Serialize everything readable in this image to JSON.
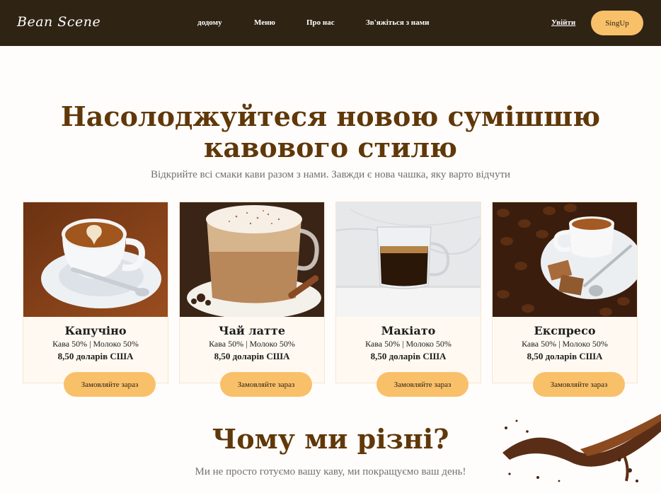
{
  "nav": {
    "logo": "Bean Scene",
    "links": [
      "додому",
      "Меню",
      "Про нас",
      "Зв'яжіться з нами"
    ],
    "login": "Увійти",
    "signup": "SingUp"
  },
  "hero": {
    "title": "Насолоджуйтеся новою сумішшю кавового стилю",
    "subtitle": "Відкрийте всі смаки кави разом з нами. Завжди є нова чашка, яку варто відчути"
  },
  "products": [
    {
      "name": "Капучіно",
      "mix": "Кава 50% | Молоко 50%",
      "price": "8,50 доларів США",
      "button": "Замовляйте зараз"
    },
    {
      "name": "Чай латте",
      "mix": "Кава 50% | Молоко 50%",
      "price": "8,50 доларів США",
      "button": "Замовляйте зараз"
    },
    {
      "name": "Макіато",
      "mix": "Кава 50% | Молоко 50%",
      "price": "8,50 доларів США",
      "button": "Замовляйте зараз"
    },
    {
      "name": "Експресо",
      "mix": "Кава 50% | Молоко 50%",
      "price": "8,50 доларів США",
      "button": "Замовляйте зараз"
    }
  ],
  "why": {
    "title": "Чому ми різні?",
    "subtitle": "Ми не просто готуємо вашу каву, ми покращуємо ваш день!"
  },
  "colors": {
    "nav_bg": "#2f2314",
    "accent": "#f9c06a",
    "heading": "#603809",
    "card_bg": "#fff9f1"
  }
}
